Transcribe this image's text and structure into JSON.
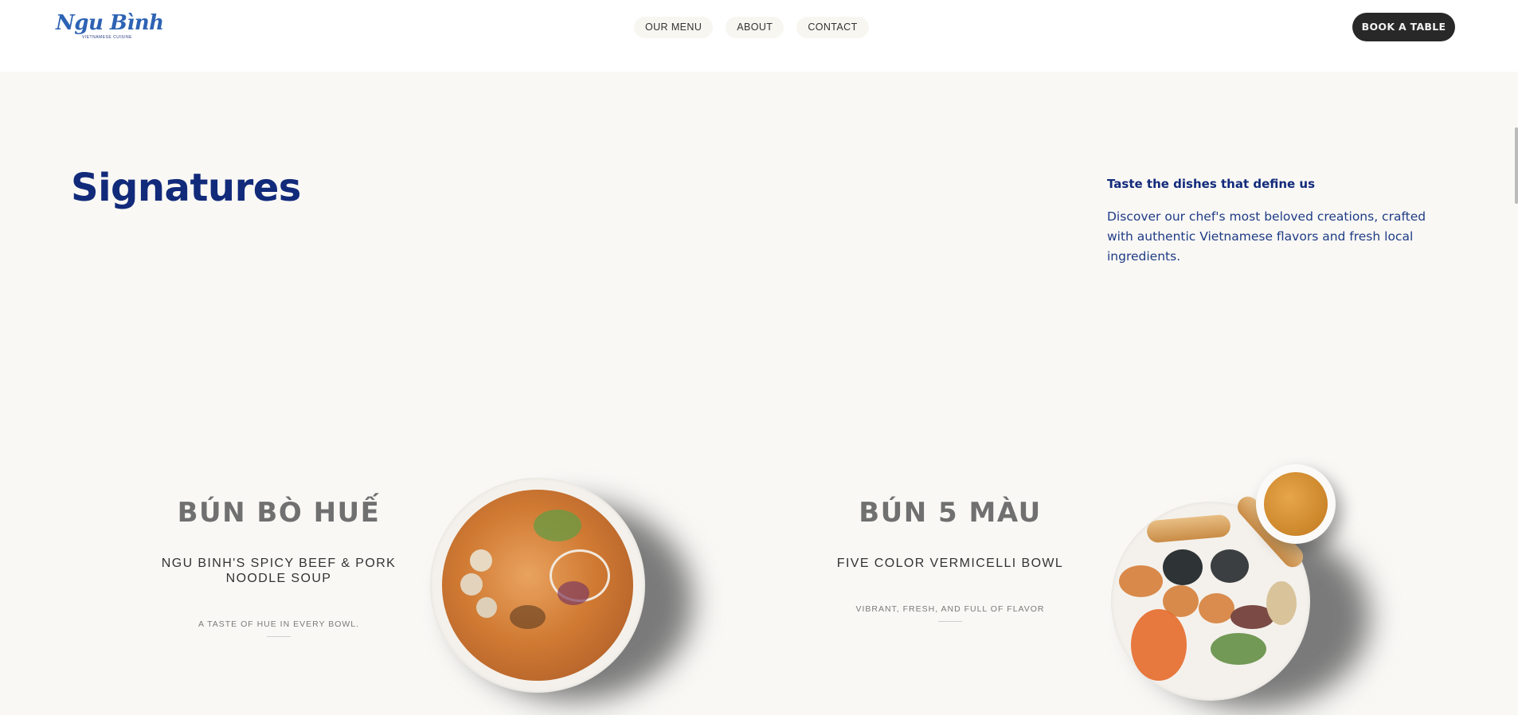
{
  "header": {
    "logo_text": "Ngu Bình",
    "logo_subtext": "VIETNAMESE CUISINE",
    "nav": [
      {
        "label": "OUR MENU"
      },
      {
        "label": "ABOUT"
      },
      {
        "label": "CONTACT"
      }
    ],
    "cta_label": "BOOK A TABLE"
  },
  "intro": {
    "title": "Signatures",
    "subtitle": "Taste the dishes that define us",
    "description": "Discover our chef's most beloved creations, crafted with authentic Vietnamese flavors and fresh local ingredients."
  },
  "dishes": [
    {
      "title": "BÚN BÒ HUẾ",
      "name": "NGU BINH'S SPICY BEEF & PORK NOODLE SOUP",
      "tagline": "A TASTE OF HUE IN EVERY BOWL."
    },
    {
      "title": "BÚN 5 MÀU",
      "name": "FIVE COLOR VERMICELLI BOWL",
      "tagline": "VIBRANT, FRESH, AND FULL OF FLAVOR"
    }
  ],
  "colors": {
    "brand_blue": "#122a7a",
    "page_bg": "#f9f8f5",
    "cta_bg": "#282828"
  }
}
